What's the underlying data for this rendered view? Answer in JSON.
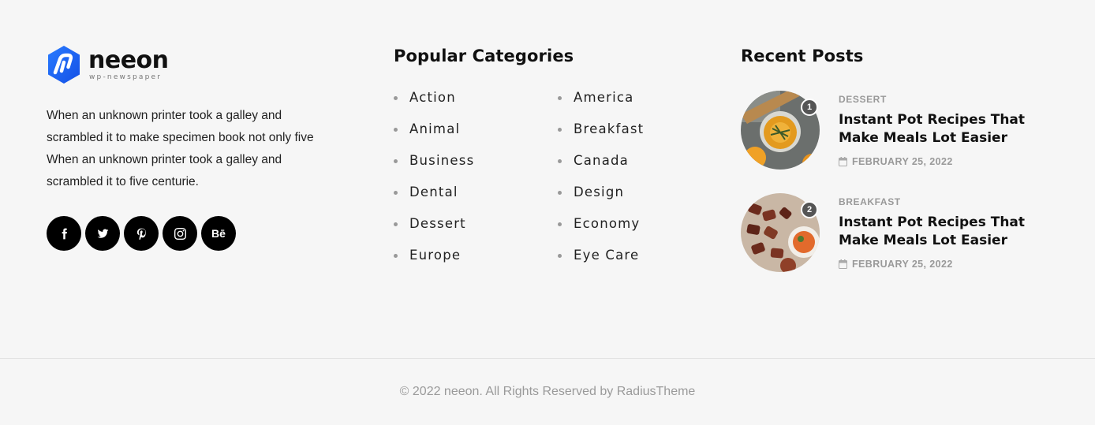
{
  "brand": {
    "name": "neeon",
    "tagline": "wp-newspaper",
    "accent": "#1a64f5"
  },
  "about": {
    "text": "When an unknown printer took a galley and scrambled it to make specimen book not only five When an unknown printer took a galley and scrambled it to five centurie."
  },
  "socials": [
    {
      "name": "facebook-icon"
    },
    {
      "name": "twitter-icon"
    },
    {
      "name": "pinterest-icon"
    },
    {
      "name": "instagram-icon"
    },
    {
      "name": "behance-icon",
      "label": "Bē"
    }
  ],
  "categories": {
    "title": "Popular Categories",
    "column1": [
      "Action",
      "Animal",
      "Business",
      "Dental",
      "Dessert",
      "Europe"
    ],
    "column2": [
      "America",
      "Breakfast",
      "Canada",
      "Design",
      "Economy",
      "Eye Care"
    ]
  },
  "recent": {
    "title": "Recent Posts",
    "posts": [
      {
        "rank": "1",
        "category": "DESSERT",
        "title": "Instant Pot Recipes That Make Meals Lot Easier",
        "date": "FEBRUARY 25, 2022"
      },
      {
        "rank": "2",
        "category": "BREAKFAST",
        "title": "Instant Pot Recipes That Make Meals Lot Easier",
        "date": "FEBRUARY 25, 2022"
      }
    ]
  },
  "footer": {
    "copyright": "© 2022 neeon. All Rights Reserved by RadiusTheme"
  }
}
